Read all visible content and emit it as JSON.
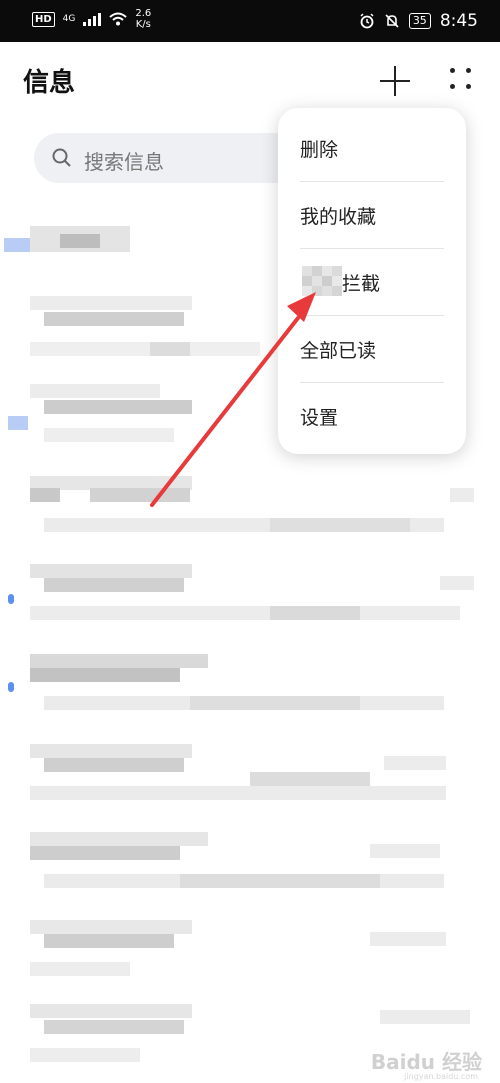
{
  "status_bar": {
    "hd_label": "HD",
    "network": "4G",
    "speed_value": "2.6",
    "speed_unit": "K/s",
    "battery": "35",
    "time": "8:45"
  },
  "header": {
    "title": "信息"
  },
  "search": {
    "placeholder": "搜索信息"
  },
  "menu": {
    "items": [
      {
        "label": "删除"
      },
      {
        "label": "我的收藏"
      },
      {
        "label": "拦截",
        "obscured_prefix": true
      },
      {
        "label": "全部已读"
      },
      {
        "label": "设置"
      }
    ]
  },
  "colors": {
    "status_bar_bg": "#0b0b0b",
    "accent_dot": "#5b8ff0",
    "arrow": "#e83a3a",
    "search_bg": "#eef0f3"
  },
  "icons": {
    "add": "plus-icon",
    "more": "more-dots-icon",
    "search": "search-icon"
  },
  "watermark": {
    "brand": "Baidu 经验",
    "url": "jingyan.baidu.com"
  }
}
